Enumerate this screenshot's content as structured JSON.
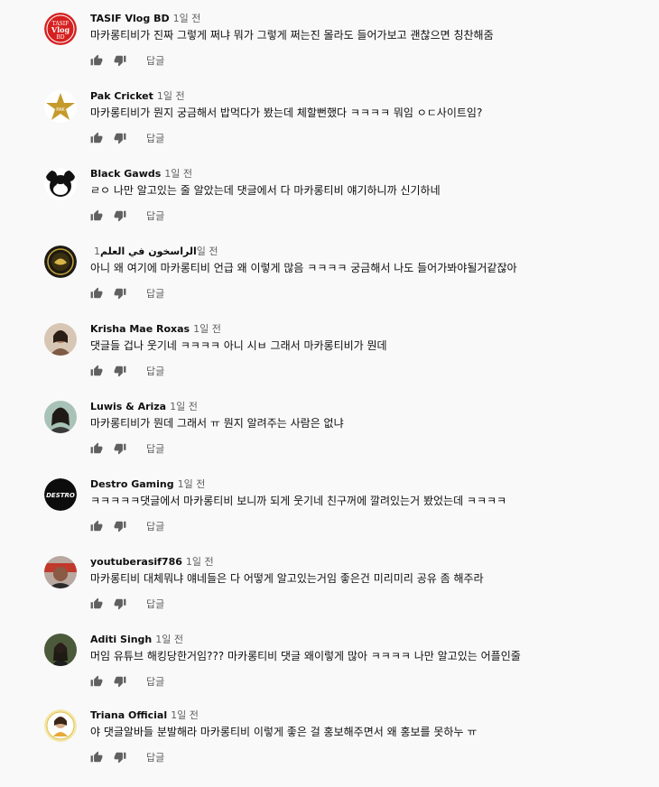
{
  "comments": [
    {
      "author": "TASIF Vlog BD",
      "time": "1일 전",
      "text": "마카롱티비가 진짜 그렇게 쩌냐 뭐가 그렇게 쩌는진 몰라도 들어가보고 괜찮으면 칭찬해줌",
      "reply": "답글",
      "avatar_color": "#d62020",
      "avatar_text": "TASIF Vlog BD"
    },
    {
      "author": "Pak Cricket",
      "time": "1일 전",
      "text": "마카롱티비가 뭔지 궁금해서 밥먹다가 봤는데 체할뻔했다 ㅋㅋㅋㅋ 뭐임 ㅇㄷ사이트임?",
      "reply": "답글",
      "avatar_color": "#b58a1e"
    },
    {
      "author": "Black Gawds",
      "time": "1일 전",
      "text": "ㄹㅇ 나만 알고있는 줄 알았는데 댓글에서 다 마카롱티비 얘기하니까 신기하네",
      "reply": "답글",
      "avatar_color": "#1a1a1a"
    },
    {
      "author": "الراسخون في العلم",
      "time": "1일 전",
      "text": "아니 왜 여기에 마카롱티비 언급 왜 이렇게 많음 ㅋㅋㅋㅋ 궁금해서 나도 들어가봐야될거같잖아",
      "reply": "답글",
      "avatar_color": "#7a5c12"
    },
    {
      "author": "Krisha Mae Roxas",
      "time": "1일 전",
      "text": "댓글들 겁나 웃기네 ㅋㅋㅋㅋ 아니 시ㅂ 그래서 마카롱티비가 뭔데",
      "reply": "답글",
      "avatar_color": "#c9a68a"
    },
    {
      "author": "Luwis & Ariza",
      "time": "1일 전",
      "text": "마카롱티비가 뭔데 그래서 ㅠ 뭔지 알려주는 사람은 없냐",
      "reply": "답글",
      "avatar_color": "#8aa69a"
    },
    {
      "author": "Destro Gaming",
      "time": "1일 전",
      "text": "ㅋㅋㅋㅋㅋ댓글에서 마카롱티비 보니까 되게 웃기네 친구꺼에 깔려있는거 봤었는데 ㅋㅋㅋㅋ",
      "reply": "답글",
      "avatar_color": "#111111"
    },
    {
      "author": "youtuberasif786",
      "time": "1일 전",
      "text": "마카롱티비 대체뭐냐 얘네들은 다 어떻게 알고있는거임 좋은건 미리미리 공유 좀 해주라",
      "reply": "답글",
      "avatar_color": "#8a5a4a"
    },
    {
      "author": "Aditi Singh",
      "time": "1일 전",
      "text": "머임 유튜브 해킹당한거임??? 마카롱티비 댓글 왜이렇게 많아 ㅋㅋㅋㅋ 나만 알고있는 어플인줄",
      "reply": "답글",
      "avatar_color": "#2f3b2a"
    },
    {
      "author": "Triana Official",
      "time": "1일 전",
      "text": "야 댓글알바들 분발해라 마카롱티비 이렇게 좋은 걸 홍보해주면서 왜 홍보를 못하누 ㅠ",
      "reply": "답글",
      "avatar_color": "#e9d27a"
    }
  ]
}
